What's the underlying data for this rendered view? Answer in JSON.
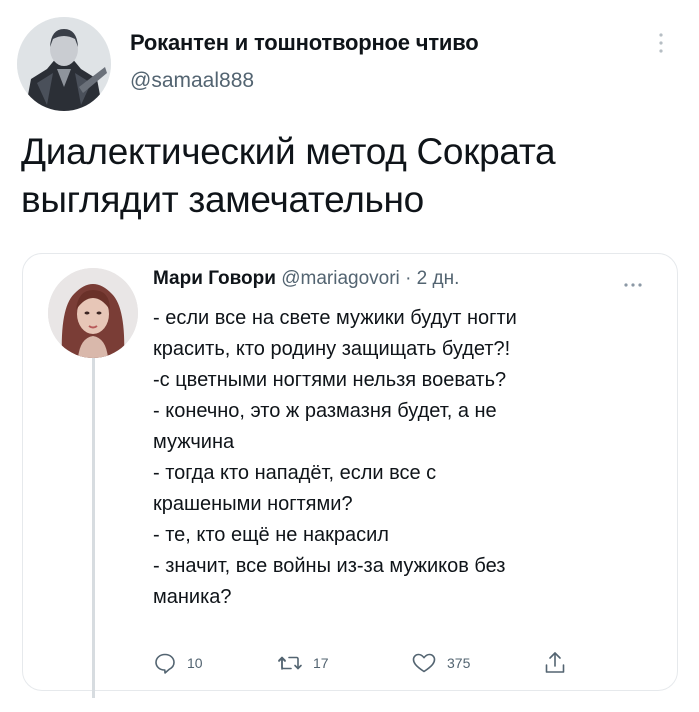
{
  "tweet": {
    "author": {
      "name": "Рокантен и тошнотворное чтиво",
      "handle": "@samaal888"
    },
    "text_lines": [
      "Диалектический метод Сократа",
      "выглядит замечательно"
    ]
  },
  "quoted": {
    "author": {
      "name": "Мари Говори",
      "handle": "@mariagovori",
      "separator": "·",
      "time": "2 дн."
    },
    "lines": [
      "- если все на свете мужики будут ногти",
      "красить, кто родину защищать будет?!",
      "-с цветными ногтями нельзя воевать?",
      "- конечно, это ж размазня будет, а не",
      "мужчина",
      "- тогда кто нападёт, если все с",
      "крашеными ногтями?",
      "- те, кто ещё не накрасил",
      "- значит, все войны из-за мужиков без",
      "маника?"
    ],
    "actions": {
      "replies": "10",
      "retweets": "17",
      "likes": "375"
    }
  },
  "icons": {
    "reply": "reply-icon",
    "retweet": "retweet-icon",
    "like": "heart-icon",
    "share": "share-icon",
    "more": "more-icon"
  },
  "colors": {
    "text": "#0f1419",
    "secondary": "#536471",
    "border": "#e6e9ec"
  }
}
